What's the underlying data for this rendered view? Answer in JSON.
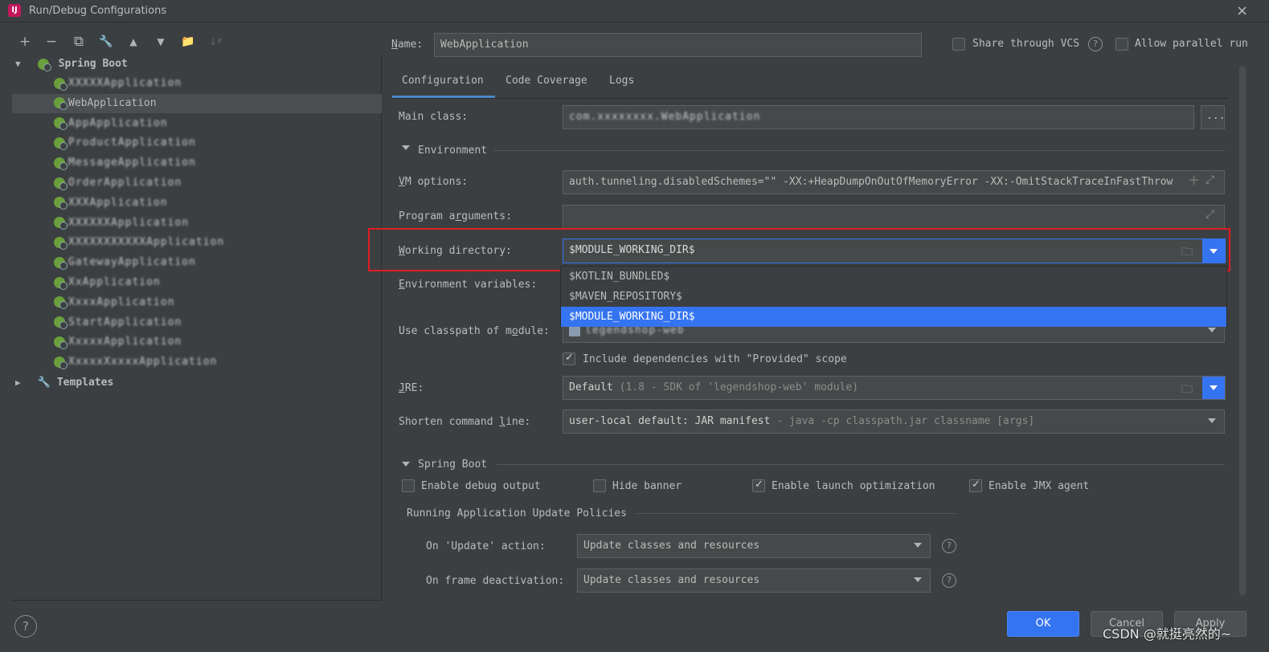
{
  "window": {
    "title": "Run/Debug Configurations",
    "logo": "IJ",
    "close": "×"
  },
  "toolbar": {
    "add": "+",
    "remove": "−",
    "copy": "⧉",
    "edit": "🔧",
    "up": "▲",
    "down": "▼",
    "folder": "📁",
    "sort": "↓ª"
  },
  "tree": {
    "root": {
      "label": "Spring Boot",
      "expanded_icon": "▼"
    },
    "items": [
      {
        "label": "XXXXXApplication"
      },
      {
        "label": "WebApplication",
        "selected": true
      },
      {
        "label": "AppApplication"
      },
      {
        "label": "ProductApplication"
      },
      {
        "label": "MessageApplication"
      },
      {
        "label": "OrderApplication"
      },
      {
        "label": "XXXApplication"
      },
      {
        "label": "XXXXXXApplication"
      },
      {
        "label": "XXXXXXXXXXXApplication"
      },
      {
        "label": "GatewayApplication"
      },
      {
        "label": "XxApplication"
      },
      {
        "label": "XxxxApplication"
      },
      {
        "label": "StartApplication"
      },
      {
        "label": "XxxxxApplication"
      },
      {
        "label": "XxxxxXxxxxApplication"
      }
    ],
    "templates": {
      "label": "Templates",
      "collapsed_icon": "▶"
    }
  },
  "header": {
    "name_label": "Name:",
    "name_value": "WebApplication",
    "share_vcs": "Share through VCS",
    "allow_parallel": "Allow parallel run"
  },
  "tabs": [
    "Configuration",
    "Code Coverage",
    "Logs"
  ],
  "form": {
    "main_class_label": "Main class:",
    "main_class_value": "com.xxxxxxxx.WebApplication",
    "browse": "...",
    "environment_section": "Environment",
    "vm_label": "VM options:",
    "vm_value": "auth.tunneling.disabledSchemes=\"\" -XX:+HeapDumpOnOutOfMemoryError -XX:-OmitStackTraceInFastThrow",
    "vm_plus": "+",
    "expand": "⤢",
    "program_args_label": "Program arguments:",
    "program_args_value": "",
    "working_dir_label": "Working directory:",
    "working_dir_value": "$MODULE_WORKING_DIR$",
    "env_vars_label": "Environment variables:",
    "classpath_label": "Use classpath of module:",
    "classpath_value": "legendshop-web",
    "include_deps": "Include dependencies with \"Provided\" scope",
    "jre_label": "JRE:",
    "jre_value_main": "Default",
    "jre_value_hint": "(1.8 - SDK of 'legendshop-web' module)",
    "shorten_label": "Shorten command line:",
    "shorten_value_main": "user-local default: JAR manifest",
    "shorten_value_hint": "- java -cp classpath.jar classname [args]"
  },
  "dropdown": {
    "options": [
      "$KOTLIN_BUNDLED$",
      "$MAVEN_REPOSITORY$",
      "$MODULE_WORKING_DIR$"
    ],
    "selected_index": 2
  },
  "spring_boot": {
    "section": "Spring Boot",
    "enable_debug": "Enable debug output",
    "hide_banner": "Hide banner",
    "launch_opt": "Enable launch optimization",
    "jmx": "Enable JMX agent",
    "policies_title": "Running Application Update Policies",
    "on_update_label": "On 'Update' action:",
    "on_update_value": "Update classes and resources",
    "on_frame_label": "On frame deactivation:",
    "on_frame_value": "Update classes and resources"
  },
  "footer": {
    "help": "?",
    "ok": "OK",
    "cancel": "Cancel",
    "apply": "Apply",
    "watermark": "CSDN @就挺亮然的~"
  },
  "colors": {
    "accent": "#3574f0",
    "highlight_box": "#e01b24",
    "selection": "#4b4f52"
  }
}
